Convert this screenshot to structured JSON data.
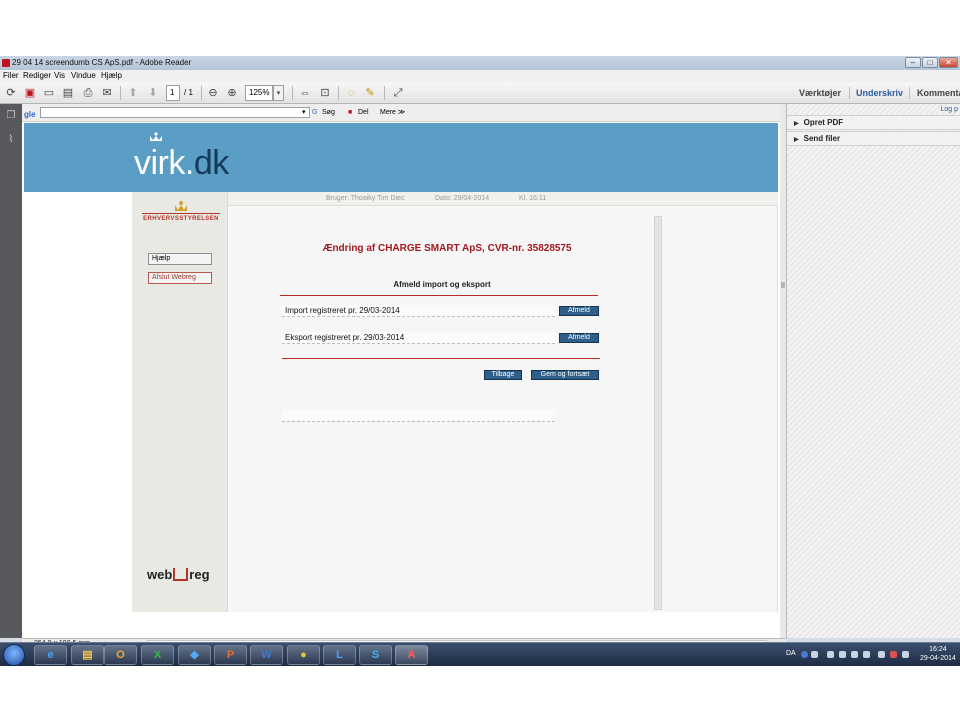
{
  "window": {
    "title": "29 04 14 screendumb CS ApS.pdf - Adobe Reader",
    "controls": [
      "–",
      "□",
      "✕"
    ]
  },
  "menu": [
    "Filer",
    "Rediger",
    "Vis",
    "Vindue",
    "Hjælp"
  ],
  "toolbar": {
    "page_current": "1",
    "page_total": "/ 1",
    "zoom": "125%",
    "right_links": [
      "Værktøjer",
      "Underskriv",
      "Kommentar"
    ]
  },
  "google_bar": {
    "logo": "gle",
    "search_label": "Søg",
    "share_label": "Del",
    "more_label": "Mere ≫"
  },
  "banner": {
    "logo_left": "virk",
    "logo_dot": ".",
    "logo_right": "dk"
  },
  "info_bar": {
    "user": "Bruger: Thoaiky Tim Diec",
    "date": "Dato: 29/04-2014",
    "time": "Kl. 16:11"
  },
  "sidebar": {
    "crest_text": "ERHVERVSSTYRELSEN",
    "help_label": "Hjælp",
    "quit_label": "Afslut Webreg",
    "webreg_left": "web",
    "webreg_right": "reg"
  },
  "form": {
    "heading": "Ændring af CHARGE SMART ApS, CVR-nr. 35828575",
    "subheading": "Afmeld import og eksport",
    "rows": [
      {
        "label": "Import registreret pr. 29/03-2014",
        "button": "Afmeld"
      },
      {
        "label": "Eksport registreret pr. 29/03-2014",
        "button": "Afmeld"
      }
    ],
    "back_label": "Tilbage",
    "save_label": "Gem og fortsæt"
  },
  "right_panel": {
    "login_link": "Log p",
    "items": [
      "Opret PDF",
      "Send filer"
    ]
  },
  "status_bar": {
    "size": "254,0 x 190,5 mm"
  },
  "taskbar": {
    "apps": [
      "e",
      "▤",
      "O",
      "X",
      "◆",
      "P",
      "W",
      "●",
      "L",
      "S",
      "A"
    ],
    "language": "DA",
    "clock_time": "16:24",
    "clock_date": "29-04-2014"
  },
  "colors": {
    "banner_blue": "#5a9dc5",
    "heading_red": "#a2191f",
    "button_blue": "#2d5f8a",
    "taskbar_dark": "#1e2c44"
  }
}
